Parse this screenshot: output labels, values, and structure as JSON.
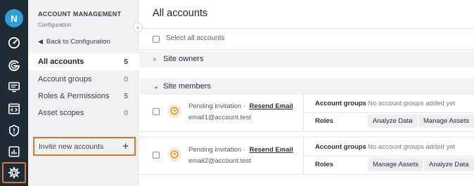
{
  "rail": {
    "avatar_initial": "N",
    "icons": [
      "speedometer-icon",
      "g-logo-icon",
      "monitor-icon",
      "code-window-icon",
      "shield-icon",
      "bar-chart-icon",
      "gear-icon"
    ],
    "active_icon": "gear-icon",
    "accent": "#d9762a"
  },
  "sidebar": {
    "title": "ACCOUNT MANAGEMENT",
    "caption": "Configuration",
    "back_label": "Back to Configuration",
    "items": [
      {
        "label": "All accounts",
        "count": "5",
        "active": true
      },
      {
        "label": "Account groups",
        "count": "0",
        "active": false
      },
      {
        "label": "Roles & Permissions",
        "count": "5",
        "active": false
      },
      {
        "label": "Asset scopes",
        "count": "0",
        "active": false
      }
    ],
    "invite_label": "Invite new accounts",
    "invite_icon": "plus-icon"
  },
  "main": {
    "title": "All accounts",
    "select_all_label": "Select all accounts",
    "sections": {
      "owners": "Site owners",
      "members": "Site members"
    },
    "members": [
      {
        "status": "Pending invitation",
        "separator": "·",
        "resend": "Resend Email",
        "email": "email1@account.test",
        "account_groups_label": "Account groups",
        "account_groups_value": "No account groups added yet",
        "roles_label": "Roles",
        "roles": [
          "Analyze Data",
          "Manage Assets"
        ]
      },
      {
        "status": "Pending invitation",
        "separator": "·",
        "resend": "Resend Email",
        "email": "email2@account.test",
        "account_groups_label": "Account groups",
        "account_groups_value": "No account groups added yet",
        "roles_label": "Roles",
        "roles": [
          "Manage Assets",
          "Analyze Data"
        ]
      }
    ]
  }
}
